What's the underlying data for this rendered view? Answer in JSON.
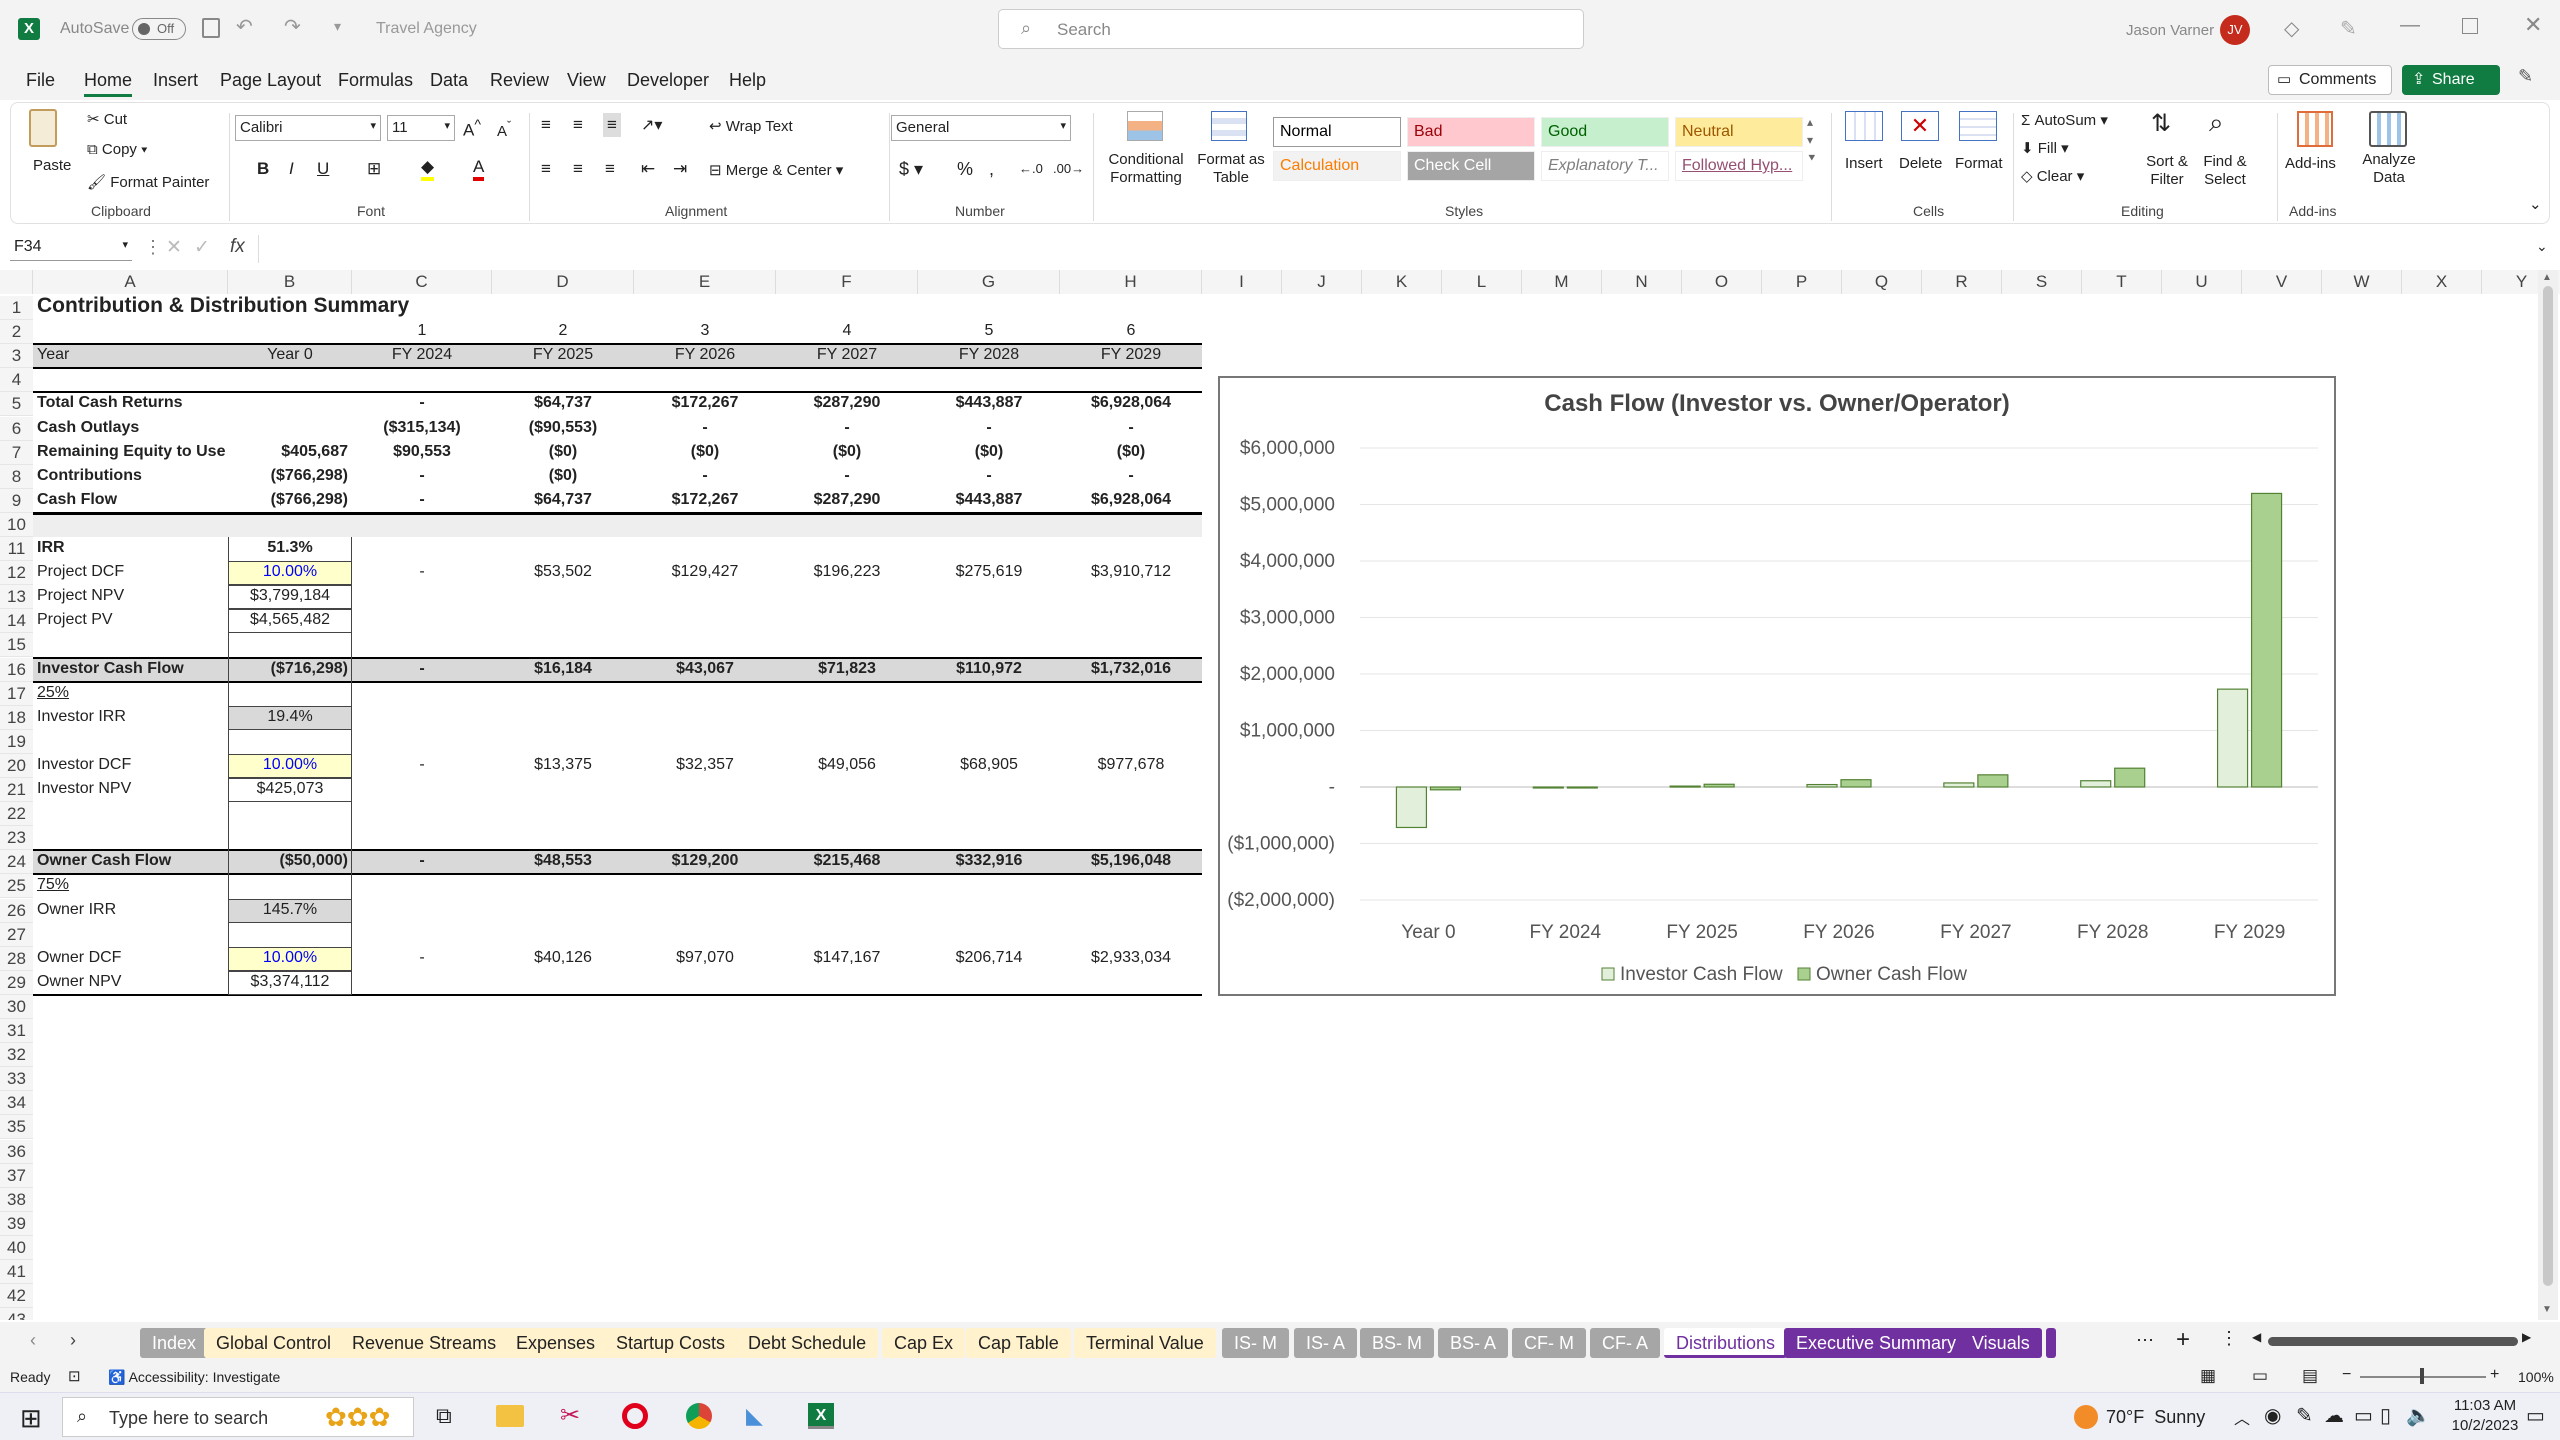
{
  "app": {
    "autosave_label": "AutoSave",
    "autosave_state": "Off",
    "doc_title": "Travel Agency",
    "search_placeholder": "Search",
    "user": "Jason Varner",
    "user_initials": "JV"
  },
  "menu": [
    "File",
    "Home",
    "Insert",
    "Page Layout",
    "Formulas",
    "Data",
    "Review",
    "View",
    "Developer",
    "Help"
  ],
  "menu_active": "Home",
  "menu_right": {
    "comments": "Comments",
    "share": "Share"
  },
  "ribbon": {
    "paste": "Paste",
    "cut": "Cut",
    "copy": "Copy",
    "format_painter": "Format Painter",
    "clipboard": "Clipboard",
    "font_name": "Calibri",
    "font_size": "11",
    "font_group": "Font",
    "wrap_text": "Wrap Text",
    "merge_center": "Merge & Center",
    "alignment": "Alignment",
    "number_format": "General",
    "number": "Number",
    "cond_format": "Conditional Formatting",
    "format_table": "Format as Table",
    "styles": [
      {
        "label": "Normal",
        "bg": "#ffffff",
        "fg": "#000000"
      },
      {
        "label": "Bad",
        "bg": "#ffc7ce",
        "fg": "#9c0006"
      },
      {
        "label": "Good",
        "bg": "#c6efce",
        "fg": "#006100"
      },
      {
        "label": "Neutral",
        "bg": "#ffeb9c",
        "fg": "#9c5700"
      },
      {
        "label": "Calculation",
        "bg": "#f2f2f2",
        "fg": "#fa7d00"
      },
      {
        "label": "Check Cell",
        "bg": "#a5a5a5",
        "fg": "#ffffff"
      },
      {
        "label": "Explanatory T...",
        "bg": "#ffffff",
        "fg": "#7f7f7f"
      },
      {
        "label": "Followed Hyp...",
        "bg": "#ffffff",
        "fg": "#954f72"
      }
    ],
    "styles_group": "Styles",
    "insert": "Insert",
    "delete": "Delete",
    "format": "Format",
    "cells": "Cells",
    "autosum": "AutoSum",
    "fill": "Fill",
    "clear": "Clear",
    "sort_filter": "Sort & Filter",
    "find_select": "Find & Select",
    "editing": "Editing",
    "addins": "Add-ins",
    "analyze": "Analyze Data",
    "addins_group": "Add-ins"
  },
  "namebox": "F34",
  "columns": [
    "A",
    "B",
    "C",
    "D",
    "E",
    "F",
    "G",
    "H",
    "I",
    "J",
    "K",
    "L",
    "M",
    "N",
    "O",
    "P",
    "Q",
    "R",
    "S",
    "T",
    "U",
    "V",
    "W",
    "X",
    "Y"
  ],
  "sheet": {
    "title": "Contribution & Distribution Summary",
    "period_nums": [
      "1",
      "2",
      "3",
      "4",
      "5",
      "6"
    ],
    "r3": {
      "a": "Year",
      "b": "Year 0",
      "vals": [
        "FY 2024",
        "FY 2025",
        "FY 2026",
        "FY 2027",
        "FY 2028",
        "FY 2029"
      ]
    },
    "r5": {
      "a": "Total Cash Returns",
      "b": "",
      "vals": [
        "-",
        "$64,737",
        "$172,267",
        "$287,290",
        "$443,887",
        "$6,928,064"
      ]
    },
    "r6": {
      "a": "Cash Outlays",
      "b": "",
      "vals": [
        "($315,134)",
        "($90,553)",
        "-",
        "-",
        "-",
        "-"
      ]
    },
    "r7": {
      "a": "Remaining Equity to Use",
      "b": "$405,687",
      "vals": [
        "$90,553",
        "($0)",
        "($0)",
        "($0)",
        "($0)",
        "($0)"
      ]
    },
    "r8": {
      "a": "Contributions",
      "b": "($766,298)",
      "vals": [
        "-",
        "($0)",
        "-",
        "-",
        "-",
        "-"
      ]
    },
    "r9": {
      "a": "Cash Flow",
      "b": "($766,298)",
      "vals": [
        "-",
        "$64,737",
        "$172,267",
        "$287,290",
        "$443,887",
        "$6,928,064"
      ]
    },
    "r11": {
      "a": "IRR",
      "b": "51.3%"
    },
    "r12": {
      "a": "Project DCF",
      "b": "10.00%",
      "vals": [
        "-",
        "$53,502",
        "$129,427",
        "$196,223",
        "$275,619",
        "$3,910,712"
      ]
    },
    "r13": {
      "a": "Project NPV",
      "b": "$3,799,184"
    },
    "r14": {
      "a": "Project PV",
      "b": "$4,565,482"
    },
    "r16": {
      "a": "Investor Cash Flow",
      "b": "($716,298)",
      "vals": [
        "-",
        "$16,184",
        "$43,067",
        "$71,823",
        "$110,972",
        "$1,732,016"
      ]
    },
    "r17": {
      "a": "25%"
    },
    "r18": {
      "a": "Investor IRR",
      "b": "19.4%"
    },
    "r20": {
      "a": "Investor DCF",
      "b": "10.00%",
      "vals": [
        "-",
        "$13,375",
        "$32,357",
        "$49,056",
        "$68,905",
        "$977,678"
      ]
    },
    "r21": {
      "a": "Investor NPV",
      "b": "$425,073"
    },
    "r24": {
      "a": "Owner Cash Flow",
      "b": "($50,000)",
      "vals": [
        "-",
        "$48,553",
        "$129,200",
        "$215,468",
        "$332,916",
        "$5,196,048"
      ]
    },
    "r25": {
      "a": "75%"
    },
    "r26": {
      "a": "Owner IRR",
      "b": "145.7%"
    },
    "r28": {
      "a": "Owner DCF",
      "b": "10.00%",
      "vals": [
        "-",
        "$40,126",
        "$97,070",
        "$147,167",
        "$206,714",
        "$2,933,034"
      ]
    },
    "r29": {
      "a": "Owner NPV",
      "b": "$3,374,112"
    }
  },
  "chart_data": {
    "type": "bar",
    "title": "Cash Flow (Investor vs. Owner/Operator)",
    "categories": [
      "Year 0",
      "FY 2024",
      "FY 2025",
      "FY 2026",
      "FY 2027",
      "FY 2028",
      "FY 2029"
    ],
    "series": [
      {
        "name": "Investor Cash Flow",
        "values": [
          -716298,
          0,
          16184,
          43067,
          71823,
          110972,
          1732016
        ],
        "color": "#e2efda"
      },
      {
        "name": "Owner Cash Flow",
        "values": [
          -50000,
          0,
          48553,
          129200,
          215468,
          332916,
          5196048
        ],
        "color": "#a9d08e"
      }
    ],
    "ylim": [
      -2000000,
      6000000
    ],
    "yticks": [
      "$6,000,000",
      "$5,000,000",
      "$4,000,000",
      "$3,000,000",
      "$2,000,000",
      "$1,000,000",
      "-",
      "($1,000,000)",
      "($2,000,000)"
    ],
    "legend_position": "bottom"
  },
  "tabs": [
    {
      "label": "Index",
      "bg": "#a6a6a6",
      "fg": "#ffffff"
    },
    {
      "label": "Global Control",
      "bg": "#fff2cc",
      "fg": "#222"
    },
    {
      "label": "Revenue Streams",
      "bg": "#fff2cc",
      "fg": "#222"
    },
    {
      "label": "Expenses",
      "bg": "#fff2cc",
      "fg": "#222"
    },
    {
      "label": "Startup Costs",
      "bg": "#fff2cc",
      "fg": "#222"
    },
    {
      "label": "Debt Schedule",
      "bg": "#fff2cc",
      "fg": "#222"
    },
    {
      "label": "Cap Ex",
      "bg": "#fff2cc",
      "fg": "#222"
    },
    {
      "label": "Cap Table",
      "bg": "#fff2cc",
      "fg": "#222"
    },
    {
      "label": "Terminal Value",
      "bg": "#fff2cc",
      "fg": "#222"
    },
    {
      "label": "IS- M",
      "bg": "#a6a6a6",
      "fg": "#ffffff"
    },
    {
      "label": "IS- A",
      "bg": "#a6a6a6",
      "fg": "#ffffff"
    },
    {
      "label": "BS- M",
      "bg": "#a6a6a6",
      "fg": "#ffffff"
    },
    {
      "label": "BS- A",
      "bg": "#a6a6a6",
      "fg": "#ffffff"
    },
    {
      "label": "CF- M",
      "bg": "#a6a6a6",
      "fg": "#ffffff"
    },
    {
      "label": "CF- A",
      "bg": "#a6a6a6",
      "fg": "#ffffff"
    },
    {
      "label": "Distributions",
      "bg": "#ffffff",
      "fg": "#7030a0"
    },
    {
      "label": "Executive Summary",
      "bg": "#7030a0",
      "fg": "#ffffff"
    },
    {
      "label": "Visuals",
      "bg": "#7030a0",
      "fg": "#ffffff"
    }
  ],
  "status": {
    "ready": "Ready",
    "accessibility": "Accessibility: Investigate",
    "zoom": "100%"
  },
  "taskbar": {
    "search": "Type here to search",
    "weather": "70°F  Sunny",
    "time": "11:03 AM",
    "date": "10/2/2023"
  }
}
